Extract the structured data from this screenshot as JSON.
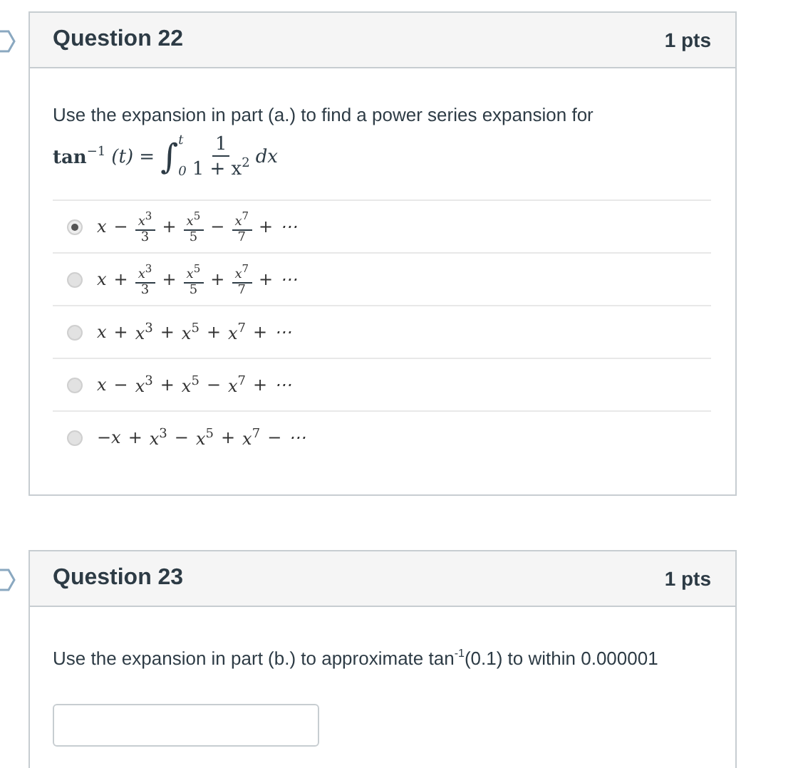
{
  "questions": [
    {
      "title": "Question 22",
      "points": "1 pts",
      "kind": "multiple_choice",
      "prompt": "Use the expansion in part (a.) to find a power series expansion for",
      "formula": [
        {
          "kind": "func",
          "base": "tan",
          "exp": "−1"
        },
        {
          "kind": "sym",
          "text": "(t) ="
        },
        {
          "kind": "int",
          "symbol": "∫",
          "upper": "t",
          "lower": "0"
        },
        {
          "kind": "frac2",
          "num": "1",
          "den": "1 + x",
          "den_exp": "2"
        },
        {
          "kind": "sym",
          "text": "dx"
        }
      ],
      "answers": [
        {
          "selected": true,
          "terms": [
            {
              "kind": "sym",
              "text": "x"
            },
            {
              "kind": "op",
              "text": "−"
            },
            {
              "kind": "frac",
              "base": "x",
              "exp": "3",
              "den": "3"
            },
            {
              "kind": "op",
              "text": "+"
            },
            {
              "kind": "frac",
              "base": "x",
              "exp": "5",
              "den": "5"
            },
            {
              "kind": "op",
              "text": "−"
            },
            {
              "kind": "frac",
              "base": "x",
              "exp": "7",
              "den": "7"
            },
            {
              "kind": "op",
              "text": "+"
            },
            {
              "kind": "sym",
              "text": "⋯"
            }
          ]
        },
        {
          "selected": false,
          "terms": [
            {
              "kind": "sym",
              "text": "x"
            },
            {
              "kind": "op",
              "text": "+"
            },
            {
              "kind": "frac",
              "base": "x",
              "exp": "3",
              "den": "3"
            },
            {
              "kind": "op",
              "text": "+"
            },
            {
              "kind": "frac",
              "base": "x",
              "exp": "5",
              "den": "5"
            },
            {
              "kind": "op",
              "text": "+"
            },
            {
              "kind": "frac",
              "base": "x",
              "exp": "7",
              "den": "7"
            },
            {
              "kind": "op",
              "text": "+"
            },
            {
              "kind": "sym",
              "text": "⋯"
            }
          ]
        },
        {
          "selected": false,
          "terms": [
            {
              "kind": "sym",
              "text": "x"
            },
            {
              "kind": "op",
              "text": "+"
            },
            {
              "kind": "pow",
              "base": "x",
              "exp": "3"
            },
            {
              "kind": "op",
              "text": "+"
            },
            {
              "kind": "pow",
              "base": "x",
              "exp": "5"
            },
            {
              "kind": "op",
              "text": "+"
            },
            {
              "kind": "pow",
              "base": "x",
              "exp": "7"
            },
            {
              "kind": "op",
              "text": "+"
            },
            {
              "kind": "sym",
              "text": "⋯"
            }
          ]
        },
        {
          "selected": false,
          "terms": [
            {
              "kind": "sym",
              "text": "x"
            },
            {
              "kind": "op",
              "text": "−"
            },
            {
              "kind": "pow",
              "base": "x",
              "exp": "3"
            },
            {
              "kind": "op",
              "text": "+"
            },
            {
              "kind": "pow",
              "base": "x",
              "exp": "5"
            },
            {
              "kind": "op",
              "text": "−"
            },
            {
              "kind": "pow",
              "base": "x",
              "exp": "7"
            },
            {
              "kind": "op",
              "text": "+"
            },
            {
              "kind": "sym",
              "text": "⋯"
            }
          ]
        },
        {
          "selected": false,
          "terms": [
            {
              "kind": "sym",
              "text": "−x"
            },
            {
              "kind": "op",
              "text": "+"
            },
            {
              "kind": "pow",
              "base": "x",
              "exp": "3"
            },
            {
              "kind": "op",
              "text": "−"
            },
            {
              "kind": "pow",
              "base": "x",
              "exp": "5"
            },
            {
              "kind": "op",
              "text": "+"
            },
            {
              "kind": "pow",
              "base": "x",
              "exp": "7"
            },
            {
              "kind": "op",
              "text": "−"
            },
            {
              "kind": "sym",
              "text": "⋯"
            }
          ]
        }
      ]
    },
    {
      "title": "Question 23",
      "points": "1 pts",
      "kind": "numeric",
      "prompt": "Use the expansion in part (b.) to approximate tan$^{-1}$(0.1) to within 0.000001"
    }
  ]
}
